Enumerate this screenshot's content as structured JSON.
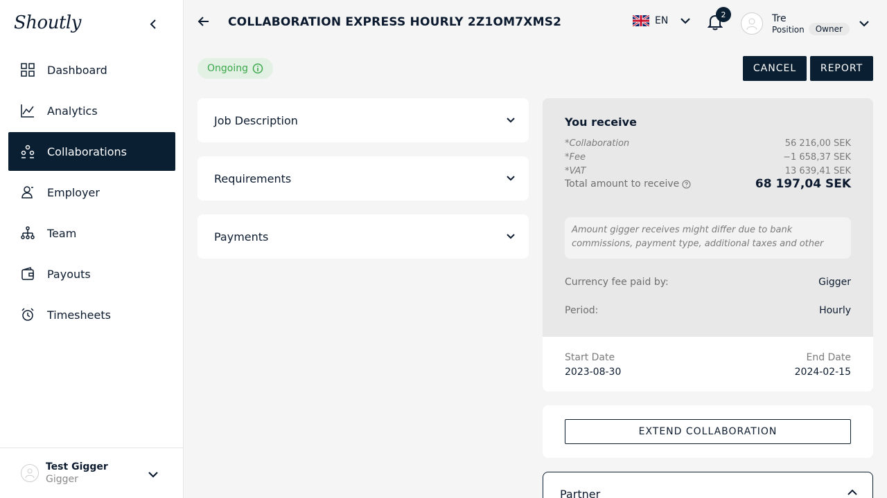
{
  "sidebar": {
    "logo": "Shoutly",
    "items": [
      {
        "label": "Dashboard",
        "icon": "dashboard-icon"
      },
      {
        "label": "Analytics",
        "icon": "analytics-icon"
      },
      {
        "label": "Collaborations",
        "icon": "collaborations-icon",
        "active": true
      },
      {
        "label": "Employer",
        "icon": "employer-icon"
      },
      {
        "label": "Team",
        "icon": "team-icon"
      },
      {
        "label": "Payouts",
        "icon": "payouts-icon"
      },
      {
        "label": "Timesheets",
        "icon": "timesheets-icon"
      }
    ],
    "user": {
      "name": "Test Gigger",
      "role": "Gigger"
    }
  },
  "header": {
    "title": "COLLABORATION EXPRESS HOURLY 2Z1OM7XMS2",
    "language": "EN",
    "notifications_count": "2",
    "profile": {
      "name": "Tre",
      "position": "Position",
      "role_badge": "Owner"
    }
  },
  "status": {
    "label": "Ongoing",
    "color": "#3aa84a"
  },
  "actions": {
    "cancel": "CANCEL",
    "report": "REPORT"
  },
  "sections": {
    "job_description": "Job Description",
    "requirements": "Requirements",
    "payments": "Payments"
  },
  "receive": {
    "title": "You receive",
    "rows": [
      {
        "label": "*Collaboration",
        "value": "56 216,00 SEK"
      },
      {
        "label": "*Fee",
        "value": "−1 658,37 SEK"
      },
      {
        "label": "*VAT",
        "value": "13 639,41 SEK"
      }
    ],
    "total_label": "Total amount to receive",
    "total_value": "68 197,04 SEK",
    "note": "Amount gigger receives might differ due to bank commissions, payment type, additional taxes and other",
    "currency_fee_label": "Currency fee paid by:",
    "currency_fee_value": "Gigger",
    "period_label": "Period:",
    "period_value": "Hourly"
  },
  "dates": {
    "start_label": "Start Date",
    "start_value": "2023-08-30",
    "end_label": "End Date",
    "end_value": "2024-02-15"
  },
  "extend_label": "EXTEND COLLABORATION",
  "partner_label": "Partner",
  "colors": {
    "primary": "#0b1f33",
    "success": "#3aa84a",
    "success_bg": "#e2f1e3"
  }
}
